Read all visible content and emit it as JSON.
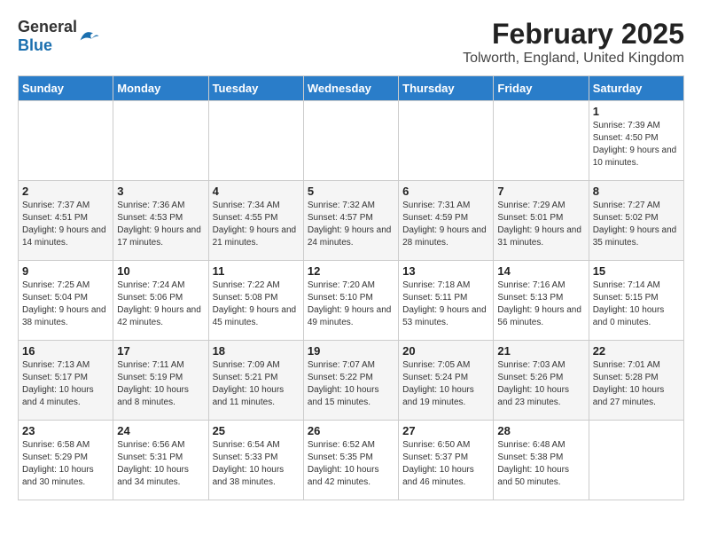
{
  "header": {
    "logo_general": "General",
    "logo_blue": "Blue",
    "title": "February 2025",
    "subtitle": "Tolworth, England, United Kingdom"
  },
  "days_of_week": [
    "Sunday",
    "Monday",
    "Tuesday",
    "Wednesday",
    "Thursday",
    "Friday",
    "Saturday"
  ],
  "weeks": [
    [
      {
        "num": "",
        "info": ""
      },
      {
        "num": "",
        "info": ""
      },
      {
        "num": "",
        "info": ""
      },
      {
        "num": "",
        "info": ""
      },
      {
        "num": "",
        "info": ""
      },
      {
        "num": "",
        "info": ""
      },
      {
        "num": "1",
        "info": "Sunrise: 7:39 AM\nSunset: 4:50 PM\nDaylight: 9 hours and 10 minutes."
      }
    ],
    [
      {
        "num": "2",
        "info": "Sunrise: 7:37 AM\nSunset: 4:51 PM\nDaylight: 9 hours and 14 minutes."
      },
      {
        "num": "3",
        "info": "Sunrise: 7:36 AM\nSunset: 4:53 PM\nDaylight: 9 hours and 17 minutes."
      },
      {
        "num": "4",
        "info": "Sunrise: 7:34 AM\nSunset: 4:55 PM\nDaylight: 9 hours and 21 minutes."
      },
      {
        "num": "5",
        "info": "Sunrise: 7:32 AM\nSunset: 4:57 PM\nDaylight: 9 hours and 24 minutes."
      },
      {
        "num": "6",
        "info": "Sunrise: 7:31 AM\nSunset: 4:59 PM\nDaylight: 9 hours and 28 minutes."
      },
      {
        "num": "7",
        "info": "Sunrise: 7:29 AM\nSunset: 5:01 PM\nDaylight: 9 hours and 31 minutes."
      },
      {
        "num": "8",
        "info": "Sunrise: 7:27 AM\nSunset: 5:02 PM\nDaylight: 9 hours and 35 minutes."
      }
    ],
    [
      {
        "num": "9",
        "info": "Sunrise: 7:25 AM\nSunset: 5:04 PM\nDaylight: 9 hours and 38 minutes."
      },
      {
        "num": "10",
        "info": "Sunrise: 7:24 AM\nSunset: 5:06 PM\nDaylight: 9 hours and 42 minutes."
      },
      {
        "num": "11",
        "info": "Sunrise: 7:22 AM\nSunset: 5:08 PM\nDaylight: 9 hours and 45 minutes."
      },
      {
        "num": "12",
        "info": "Sunrise: 7:20 AM\nSunset: 5:10 PM\nDaylight: 9 hours and 49 minutes."
      },
      {
        "num": "13",
        "info": "Sunrise: 7:18 AM\nSunset: 5:11 PM\nDaylight: 9 hours and 53 minutes."
      },
      {
        "num": "14",
        "info": "Sunrise: 7:16 AM\nSunset: 5:13 PM\nDaylight: 9 hours and 56 minutes."
      },
      {
        "num": "15",
        "info": "Sunrise: 7:14 AM\nSunset: 5:15 PM\nDaylight: 10 hours and 0 minutes."
      }
    ],
    [
      {
        "num": "16",
        "info": "Sunrise: 7:13 AM\nSunset: 5:17 PM\nDaylight: 10 hours and 4 minutes."
      },
      {
        "num": "17",
        "info": "Sunrise: 7:11 AM\nSunset: 5:19 PM\nDaylight: 10 hours and 8 minutes."
      },
      {
        "num": "18",
        "info": "Sunrise: 7:09 AM\nSunset: 5:21 PM\nDaylight: 10 hours and 11 minutes."
      },
      {
        "num": "19",
        "info": "Sunrise: 7:07 AM\nSunset: 5:22 PM\nDaylight: 10 hours and 15 minutes."
      },
      {
        "num": "20",
        "info": "Sunrise: 7:05 AM\nSunset: 5:24 PM\nDaylight: 10 hours and 19 minutes."
      },
      {
        "num": "21",
        "info": "Sunrise: 7:03 AM\nSunset: 5:26 PM\nDaylight: 10 hours and 23 minutes."
      },
      {
        "num": "22",
        "info": "Sunrise: 7:01 AM\nSunset: 5:28 PM\nDaylight: 10 hours and 27 minutes."
      }
    ],
    [
      {
        "num": "23",
        "info": "Sunrise: 6:58 AM\nSunset: 5:29 PM\nDaylight: 10 hours and 30 minutes."
      },
      {
        "num": "24",
        "info": "Sunrise: 6:56 AM\nSunset: 5:31 PM\nDaylight: 10 hours and 34 minutes."
      },
      {
        "num": "25",
        "info": "Sunrise: 6:54 AM\nSunset: 5:33 PM\nDaylight: 10 hours and 38 minutes."
      },
      {
        "num": "26",
        "info": "Sunrise: 6:52 AM\nSunset: 5:35 PM\nDaylight: 10 hours and 42 minutes."
      },
      {
        "num": "27",
        "info": "Sunrise: 6:50 AM\nSunset: 5:37 PM\nDaylight: 10 hours and 46 minutes."
      },
      {
        "num": "28",
        "info": "Sunrise: 6:48 AM\nSunset: 5:38 PM\nDaylight: 10 hours and 50 minutes."
      },
      {
        "num": "",
        "info": ""
      }
    ]
  ]
}
